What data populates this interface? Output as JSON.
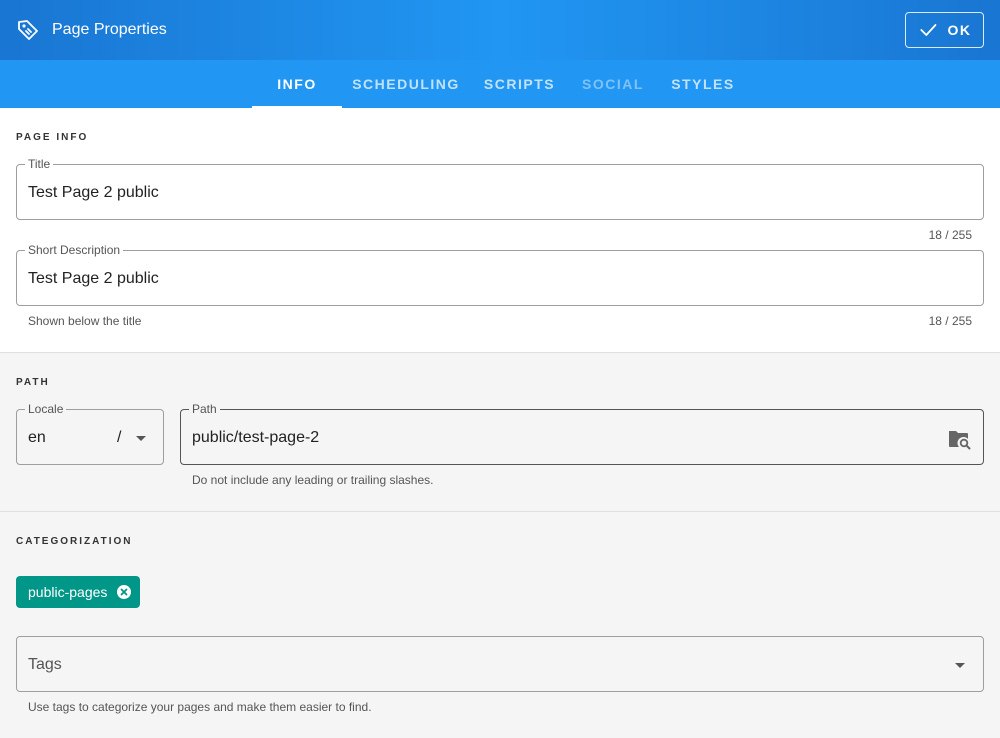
{
  "header": {
    "title": "Page Properties",
    "ok_label": "OK"
  },
  "tabs": [
    {
      "label": "INFO",
      "state": "active"
    },
    {
      "label": "SCHEDULING",
      "state": "normal"
    },
    {
      "label": "SCRIPTS",
      "state": "normal"
    },
    {
      "label": "SOCIAL",
      "state": "disabled"
    },
    {
      "label": "STYLES",
      "state": "normal"
    }
  ],
  "page_info": {
    "section_label": "PAGE INFO",
    "title_label": "Title",
    "title_value": "Test Page 2 public",
    "title_counter": "18 / 255",
    "desc_label": "Short Description",
    "desc_value": "Test Page 2 public",
    "desc_hint": "Shown below the title",
    "desc_counter": "18 / 255"
  },
  "path": {
    "section_label": "PATH",
    "locale_label": "Locale",
    "locale_value": "en",
    "locale_separator": "/",
    "path_label": "Path",
    "path_value": "public/test-page-2",
    "path_hint": "Do not include any leading or trailing slashes."
  },
  "categorization": {
    "section_label": "CATEGORIZATION",
    "chips": [
      "public-pages"
    ],
    "tags_placeholder": "Tags",
    "tags_hint": "Use tags to categorize your pages and make them easier to find."
  },
  "colors": {
    "header": "#1976d2",
    "tabs": "#2196f3",
    "chip": "#009688"
  }
}
